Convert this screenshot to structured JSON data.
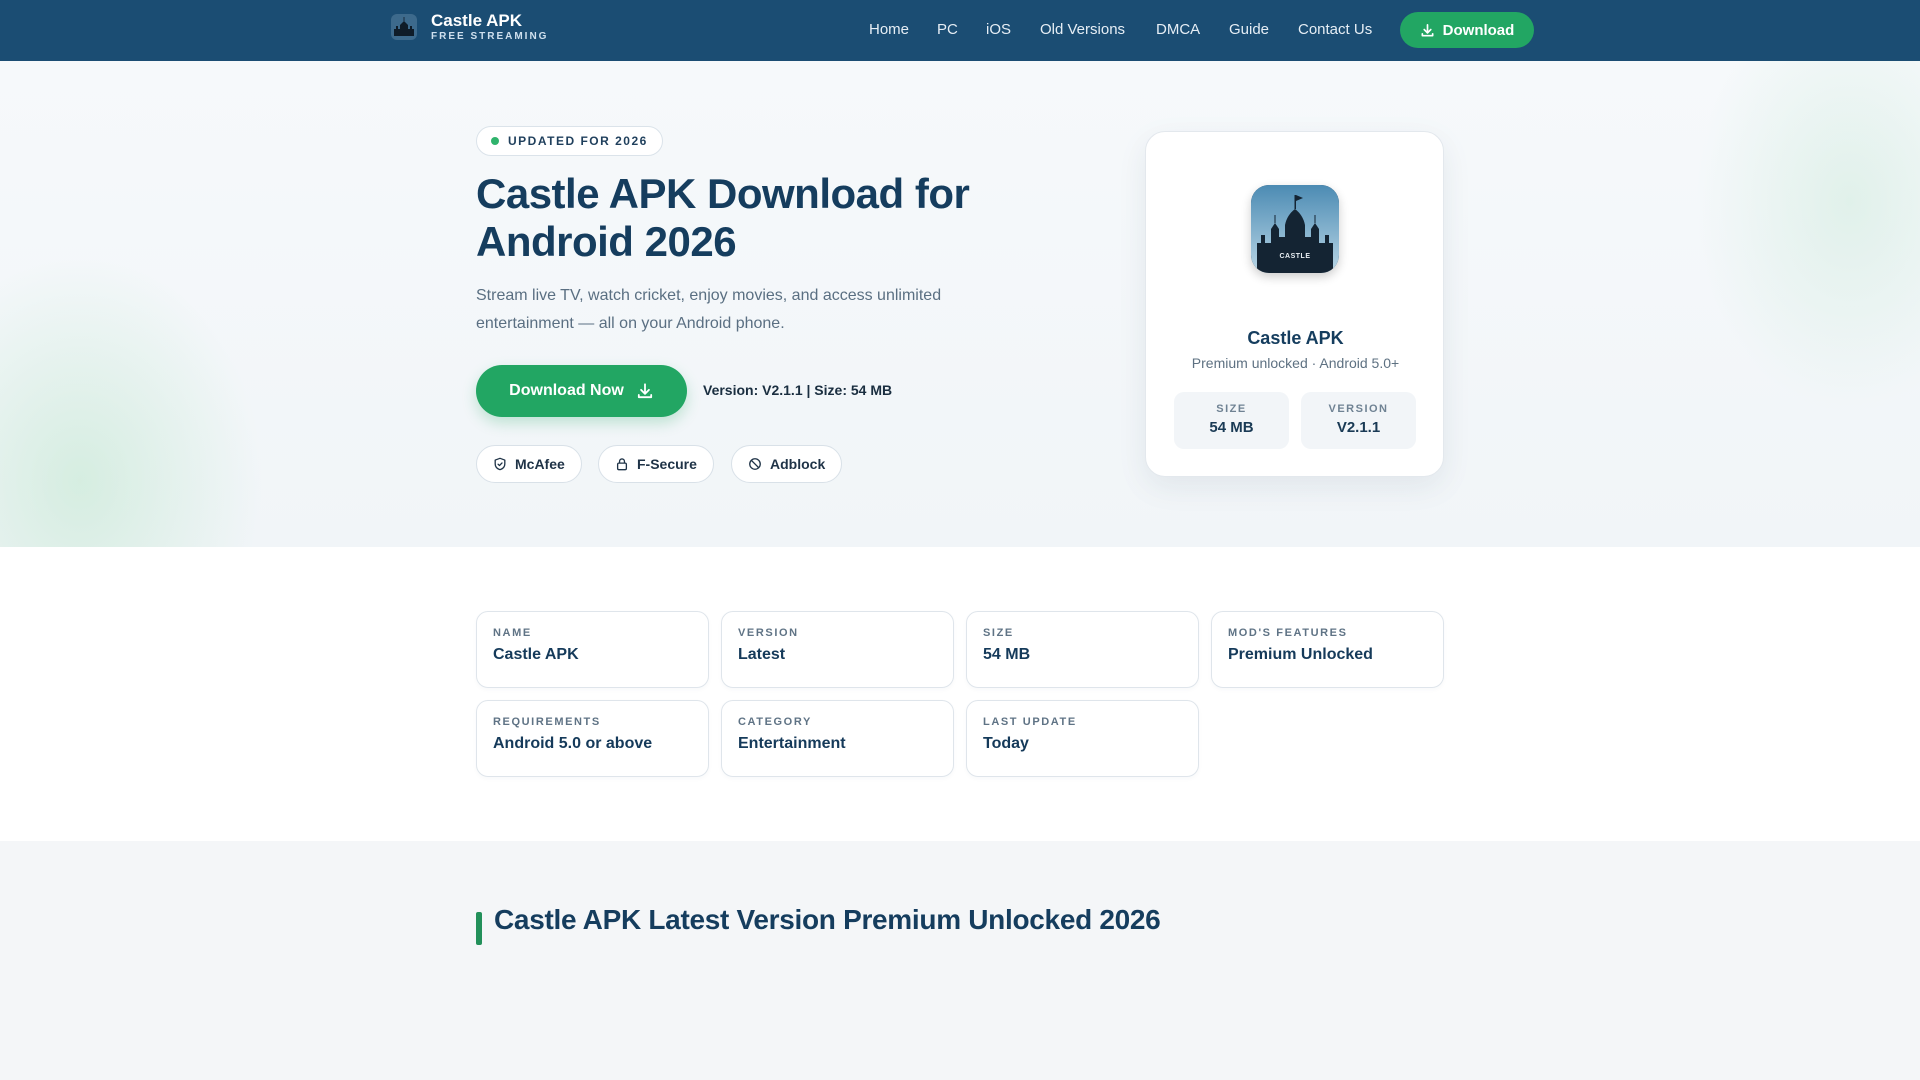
{
  "nav": {
    "brand_title": "Castle APK",
    "brand_sub": "FREE STREAMING",
    "links": [
      "Home",
      "PC",
      "iOS",
      "Old Versions",
      "DMCA",
      "Guide",
      "Contact Us"
    ],
    "cta_label": "Download"
  },
  "hero": {
    "badge": "UPDATED FOR 2026",
    "title": "Castle APK Download for Android 2026",
    "description": "Stream live TV, watch cricket, enjoy movies, and access unlimited entertainment — all on your Android phone.",
    "download_label": "Download Now",
    "meta": "Version: V2.1.1 | Size: 54 MB",
    "chips": [
      {
        "label": "McAfee",
        "icon": "shield-icon"
      },
      {
        "label": "F-Secure",
        "icon": "lock-icon"
      },
      {
        "label": "Adblock",
        "icon": "block-icon"
      }
    ]
  },
  "app_card": {
    "icon_text": "CASTLE",
    "name": "Castle APK",
    "subtitle": "Premium unlocked · Android 5.0+",
    "stats": [
      {
        "label": "SIZE",
        "value": "54 MB"
      },
      {
        "label": "VERSION",
        "value": "V2.1.1"
      }
    ]
  },
  "info": [
    {
      "label": "NAME",
      "value": "Castle APK"
    },
    {
      "label": "VERSION",
      "value": "Latest"
    },
    {
      "label": "SIZE",
      "value": "54 MB"
    },
    {
      "label": "MOD'S FEATURES",
      "value": "Premium Unlocked"
    },
    {
      "label": "REQUIREMENTS",
      "value": "Android 5.0 or above"
    },
    {
      "label": "CATEGORY",
      "value": "Entertainment"
    },
    {
      "label": "LAST UPDATE",
      "value": "Today"
    }
  ],
  "section": {
    "title": "Castle APK Latest Version Premium Unlocked 2026"
  },
  "colors": {
    "nav_bg": "#1b4d73",
    "accent_green": "#22a663",
    "heading": "#153d5e"
  }
}
